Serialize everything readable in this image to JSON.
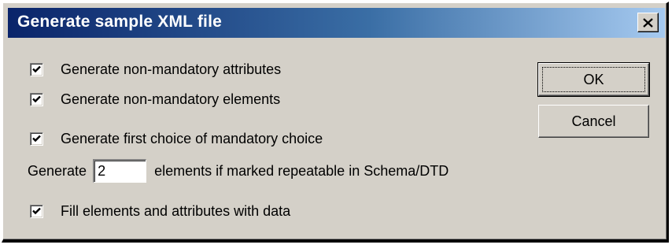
{
  "dialog": {
    "title": "Generate sample XML file",
    "close_label": "×"
  },
  "options": [
    {
      "label": "Generate non-mandatory attributes",
      "checked": true
    },
    {
      "label": "Generate non-mandatory elements",
      "checked": true
    },
    {
      "label": "Generate first choice of mandatory choice",
      "checked": true
    },
    {
      "label": "Fill elements and attributes with data",
      "checked": true
    }
  ],
  "repeat": {
    "prefix": "Generate",
    "value": "2",
    "suffix": "elements if marked repeatable in Schema/DTD"
  },
  "buttons": {
    "ok": "OK",
    "cancel": "Cancel"
  },
  "icons": {
    "close": "close-icon",
    "checkmark": "checkmark-icon"
  }
}
